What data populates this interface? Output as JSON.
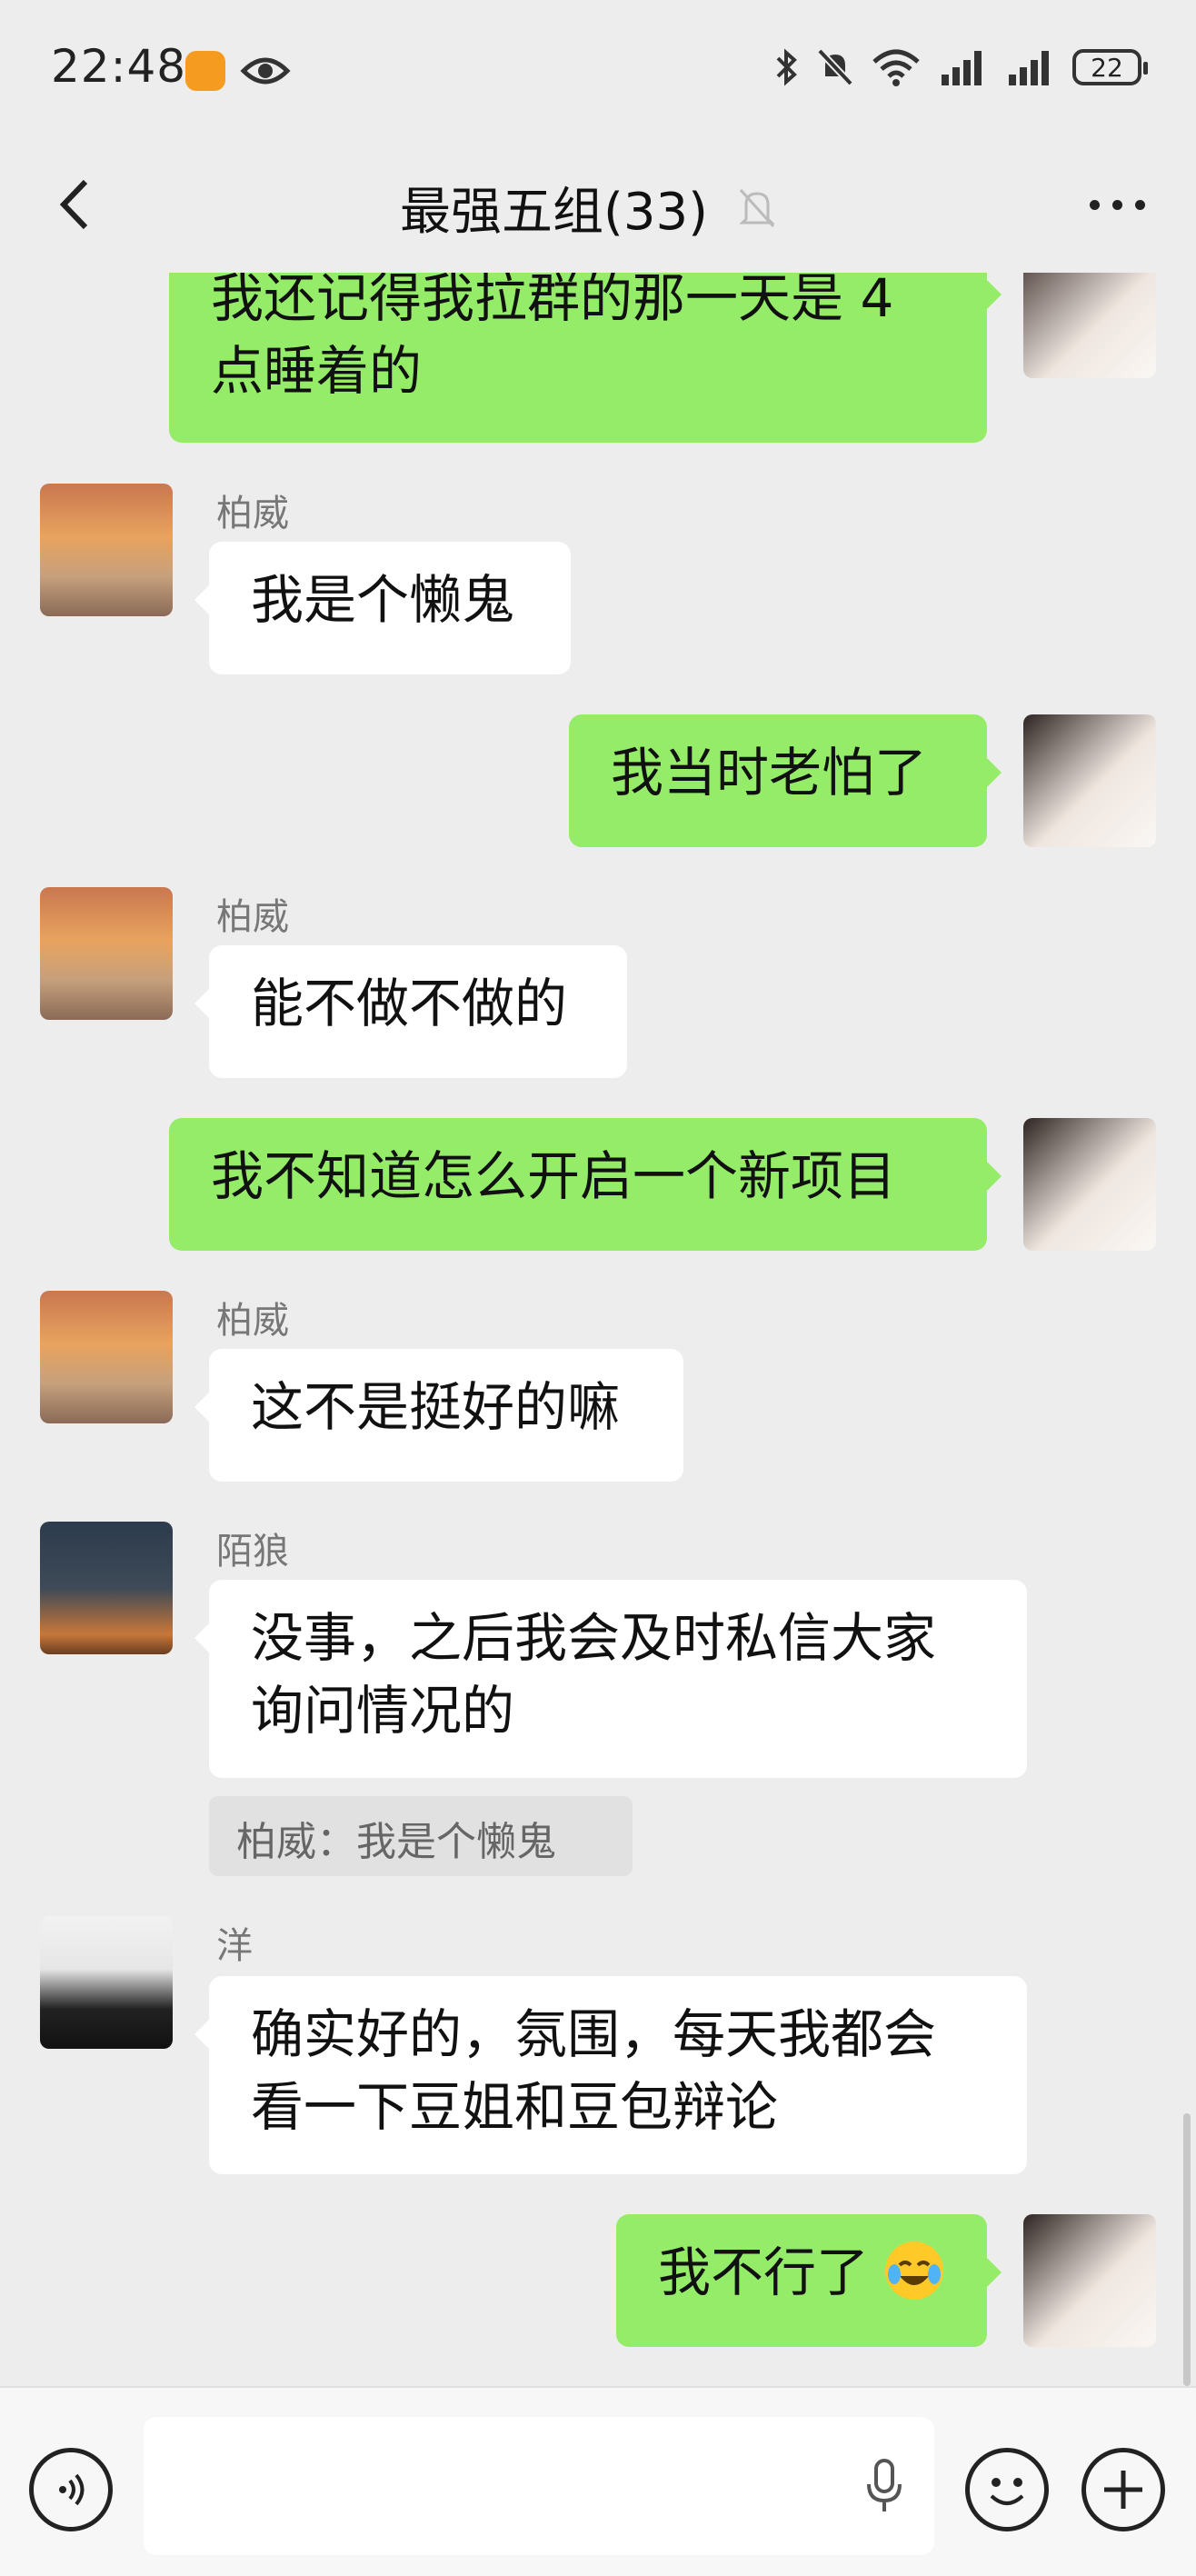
{
  "status_bar": {
    "time": "22:48",
    "battery": "22"
  },
  "header": {
    "title": "最强五组(33)"
  },
  "colors": {
    "outgoing_bubble": "#95ec69",
    "incoming_bubble": "#ffffff",
    "background": "#ededed"
  },
  "messages": [
    {
      "sender": "me",
      "text": "我还记得我拉群的那一天是 4 点睡着的"
    },
    {
      "sender": "柏威",
      "text": "我是个懒鬼"
    },
    {
      "sender": "me",
      "text": "我当时老怕了"
    },
    {
      "sender": "柏威",
      "text": "能不做不做的"
    },
    {
      "sender": "me",
      "text": "我不知道怎么开启一个新项目"
    },
    {
      "sender": "柏威",
      "text": "这不是挺好的嘛"
    },
    {
      "sender": "陌狼",
      "text": "没事，之后我会及时私信大家询问情况的",
      "quote": "柏威：我是个懒鬼"
    },
    {
      "sender": "洋",
      "text": "确实好的，氛围，每天我都会看一下豆姐和豆包辩论"
    },
    {
      "sender": "me",
      "text": "我不行了",
      "emoji": "crying-laughing-emoji"
    }
  ]
}
